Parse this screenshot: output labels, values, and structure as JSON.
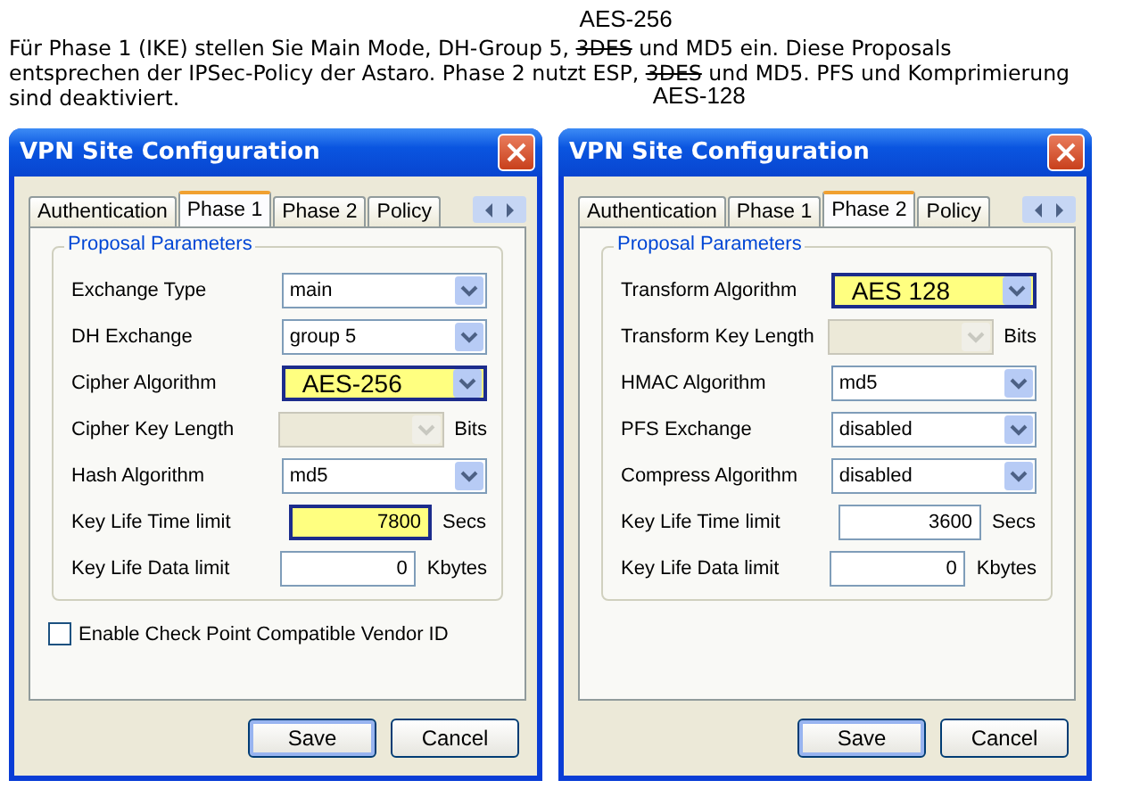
{
  "intro": {
    "lines": [
      [
        {
          "text": "Für Phase 1 (IKE) stellen Sie Main Mode, DH-Group 5, "
        },
        {
          "kind": "correction",
          "text": "3DES",
          "note_above": "AES-256"
        },
        {
          "text": " und MD5 ein. Diese Proposals"
        }
      ],
      [
        {
          "text": "entsprechen der IPSec-Policy der Astaro. Phase 2 nutzt ESP, "
        },
        {
          "kind": "correction",
          "text": "3DES",
          "note_below": "AES-128"
        },
        {
          "text": " und MD5. PFS und Komprimierung"
        }
      ],
      [
        {
          "text": "sind deaktiviert."
        }
      ]
    ]
  },
  "dialogs": [
    {
      "title": "VPN Site Configuration",
      "tabs": [
        {
          "label": "Authentication",
          "selected": false
        },
        {
          "label": "Phase 1",
          "selected": true
        },
        {
          "label": "Phase 2",
          "selected": false
        },
        {
          "label": "Policy",
          "selected": false
        }
      ],
      "group": {
        "title": "Proposal Parameters",
        "rows": [
          {
            "label": "Exchange Type",
            "kind": "combo",
            "value": "main",
            "disabled": false,
            "highlighted": false
          },
          {
            "label": "DH Exchange",
            "kind": "combo",
            "value": "group 5",
            "disabled": false,
            "highlighted": false
          },
          {
            "label": "Cipher Algorithm",
            "kind": "combo",
            "value": "AES-256",
            "disabled": false,
            "highlighted": true
          },
          {
            "label": "Cipher Key Length",
            "kind": "combo",
            "disabled": true,
            "highlighted": false,
            "unit": "Bits"
          },
          {
            "label": "Hash Algorithm",
            "kind": "combo",
            "value": "md5",
            "disabled": false,
            "highlighted": false
          },
          {
            "label": "Key Life Time limit",
            "kind": "number",
            "value": "7800",
            "disabled": false,
            "highlighted": true,
            "unit": "Secs"
          },
          {
            "label": "Key Life Data limit",
            "kind": "number",
            "value": "0",
            "disabled": false,
            "highlighted": false,
            "unit": "Kbytes"
          }
        ]
      },
      "checkbox": {
        "label": "Enable Check Point Compatible Vendor ID",
        "checked": false
      },
      "buttons": [
        {
          "label": "Save",
          "default": true
        },
        {
          "label": "Cancel",
          "default": false
        }
      ]
    },
    {
      "title": "VPN Site Configuration",
      "tabs": [
        {
          "label": "Authentication",
          "selected": false
        },
        {
          "label": "Phase 1",
          "selected": false
        },
        {
          "label": "Phase 2",
          "selected": true
        },
        {
          "label": "Policy",
          "selected": false
        }
      ],
      "group": {
        "title": "Proposal Parameters",
        "rows": [
          {
            "label": "Transform Algorithm",
            "kind": "combo",
            "value": "AES 128",
            "disabled": false,
            "highlighted": true
          },
          {
            "label": "Transform Key Length",
            "kind": "combo",
            "disabled": true,
            "highlighted": false,
            "unit": "Bits"
          },
          {
            "label": "HMAC Algorithm",
            "kind": "combo",
            "value": "md5",
            "disabled": false,
            "highlighted": false
          },
          {
            "label": "PFS Exchange",
            "kind": "combo",
            "value": "disabled",
            "disabled": false,
            "highlighted": false
          },
          {
            "label": "Compress Algorithm",
            "kind": "combo",
            "value": "disabled",
            "disabled": false,
            "highlighted": false
          },
          {
            "label": "Key Life Time limit",
            "kind": "number",
            "value": "3600",
            "disabled": false,
            "highlighted": false,
            "unit": "Secs"
          },
          {
            "label": "Key Life Data limit",
            "kind": "number",
            "value": "0",
            "disabled": false,
            "highlighted": false,
            "unit": "Kbytes"
          }
        ]
      },
      "buttons": [
        {
          "label": "Save",
          "default": true
        },
        {
          "label": "Cancel",
          "default": false
        }
      ]
    }
  ]
}
